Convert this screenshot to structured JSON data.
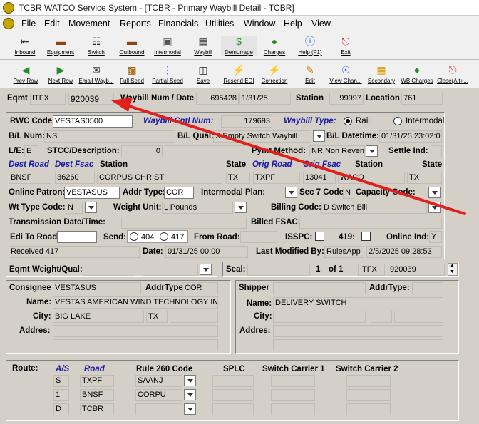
{
  "window": {
    "title": "TCBR WATCO Service System - [TCBR - Primary Waybill Detail - TCBR]"
  },
  "menu": [
    "File",
    "Edit",
    "Movement",
    "Reports",
    "Financials",
    "Utilities",
    "Window",
    "Help",
    "View"
  ],
  "toolbar1": [
    "Inbound",
    "Equipment",
    "Switch",
    "Outbound",
    "Intermodal",
    "Waybill",
    "Demurrage",
    "Charges",
    "Help (F1)",
    "Exit"
  ],
  "toolbar2": [
    "Prev Row",
    "Next Row",
    "Email Wayb...",
    "Full Seed",
    "Partial Seed",
    "Save",
    "Resend EDI",
    "Correction",
    "Edit",
    "View Chan...",
    "Secondary",
    "WB Charges",
    "Close(Alt+..."
  ],
  "header": {
    "eqmt_label": "Eqmt",
    "eqmt_init": "ITFX",
    "eqmt_num": "920039",
    "waybill_label": "Waybill Num / Date",
    "waybill_num": "695428",
    "waybill_date": "1/31/25",
    "station_label": "Station",
    "station_num": "99997",
    "location_label": "Location",
    "location_num": "761"
  },
  "form": {
    "rwc_code_label": "RWC Code:",
    "rwc_code": "VESTAS0500",
    "waybill_cntl_label": "Waybill Cntl Num:",
    "waybill_cntl": "179693",
    "waybill_type_label": "Waybill Type:",
    "rail_label": "Rail",
    "intermodal_label": "Intermodal",
    "bl_num_label": "B/L Num:",
    "bl_num": "NS",
    "bl_qual_label": "B/L Qual:",
    "bl_qual": "X Empty Switch Waybill",
    "bl_datetime_label": "B/L Datetime:",
    "bl_datetime": "01/31/25 23:02:00",
    "le_label": "L/E:",
    "le": "E",
    "stcc_label": "STCC/Description:",
    "stcc": "0",
    "pymt_label": "Pymt Method:",
    "pymt": "NR Non Revenue",
    "settle_label": "Settle Ind:",
    "dest_road_label": "Dest Road",
    "dest_fsac_label": "Dest Fsac",
    "dest_station_label": "Station",
    "dest_state_label": "State",
    "orig_road_label": "Orig Road",
    "orig_fsac_label": "Orig Fsac",
    "orig_station_label": "Station",
    "orig_state_label": "State",
    "dest_road": "BNSF",
    "dest_fsac": "36260",
    "dest_station": "CORPUS CHRISTI",
    "dest_state": "TX",
    "orig_road": "TXPF",
    "orig_fsac": "13041",
    "orig_station": "WACO",
    "orig_state": "TX",
    "online_patron_label": "Online Patron:",
    "online_patron": "VESTASUS",
    "addr_type_label": "Addr Type:",
    "addr_type": "COR",
    "intermodal_plan_label": "Intermodal Plan:",
    "sec7_label": "Sec 7 Code:",
    "sec7": "N",
    "capacity_label": "Capacity Code:",
    "wt_type_label": "Wt Type Code:",
    "wt_type": "N",
    "weight_unit_label": "Weight Unit:",
    "weight_unit": "L Pounds",
    "billing_code_label": "Billing Code:",
    "billing_code": "D Switch Bill",
    "transmission_label": "Transmission Date/Time:",
    "billed_fsac_label": "Billed FSAC:",
    "edi_road_label": "Edi To Road:",
    "send_label": "Send:",
    "send_404": "404",
    "send_417": "417",
    "from_road_label": "From Road:",
    "isspc_label": "ISSPC:",
    "code419_label": "419:",
    "online_ind_label": "Online Ind:",
    "online_ind": "Y",
    "received": "Received 417",
    "date_label": "Date:",
    "date": "01/31/25 00:00",
    "last_mod_label": "Last Modified By:",
    "last_mod_by": "RulesApp",
    "last_mod_date": "2/5/2025 09:28:53"
  },
  "eqmt_weight": {
    "label": "Eqmt Weight/Qual:",
    "seal_label": "Seal:",
    "seal_index": "1",
    "of_label": "of 1",
    "seal_init": "ITFX",
    "seal_num": "920039"
  },
  "consignee": {
    "label": "Consignee",
    "code": "VESTASUS",
    "addr_type_label": "AddrType:",
    "addr_type": "COR",
    "name_label": "Name:",
    "name": "VESTAS AMERICAN WIND TECHNOLOGY INC",
    "city_label": "City:",
    "city": "BIG LAKE",
    "state": "TX",
    "address_label": "Addres:"
  },
  "shipper": {
    "label": "Shipper",
    "addr_type_label": "AddrType:",
    "name_label": "Name:",
    "name": "DELIVERY SWITCH",
    "city_label": "City:",
    "address_label": "Addres:"
  },
  "route": {
    "label": "Route:",
    "as_label": "A/S",
    "road_label": "Road",
    "rule260_label": "Rule 260 Code",
    "splc_label": "SPLC",
    "sw1_label": "Switch Carrier 1",
    "sw2_label": "Switch Carrier 2",
    "rows": [
      {
        "as": "S",
        "road": "TXPF",
        "rule": "SAANJ"
      },
      {
        "as": "1",
        "road": "BNSF",
        "rule": "CORPU"
      },
      {
        "as": "D",
        "road": "TCBR",
        "rule": ""
      }
    ]
  },
  "colors": {
    "arrow": "#e0201c",
    "blue_label": "#1a1aa6",
    "form_bg": "#d4d0c8"
  }
}
